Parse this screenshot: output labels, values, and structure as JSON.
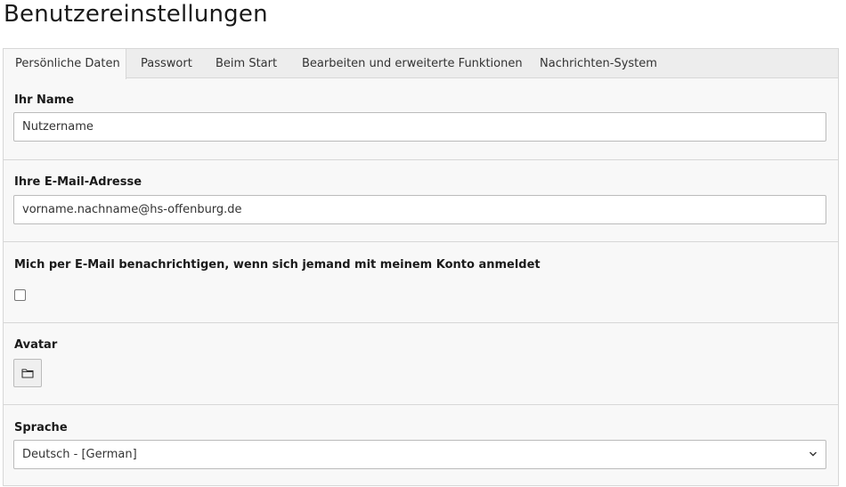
{
  "page": {
    "title": "Benutzereinstellungen"
  },
  "tabs": [
    {
      "label": "Persönliche Daten",
      "active": true
    },
    {
      "label": "Passwort",
      "active": false
    },
    {
      "label": "Beim Start",
      "active": false
    },
    {
      "label": "Bearbeiten und erweiterte Funktionen",
      "active": false
    },
    {
      "label": "Nachrichten-System",
      "active": false
    }
  ],
  "fields": {
    "name": {
      "label": "Ihr Name",
      "value": "Nutzername"
    },
    "email": {
      "label": "Ihre E-Mail-Adresse",
      "value": "vorname.nachname@hs-offenburg.de"
    },
    "notify": {
      "label": "Mich per E-Mail benachrichtigen, wenn sich jemand mit meinem Konto anmeldet",
      "checked": false
    },
    "avatar": {
      "label": "Avatar",
      "icon": "folder-icon"
    },
    "language": {
      "label": "Sprache",
      "value": "Deutsch - [German]",
      "icon": "chevron-down-icon"
    }
  },
  "colors": {
    "panel_bg": "#f8f8f8",
    "tabbar_bg": "#ededed",
    "border": "#d7d7d7"
  }
}
